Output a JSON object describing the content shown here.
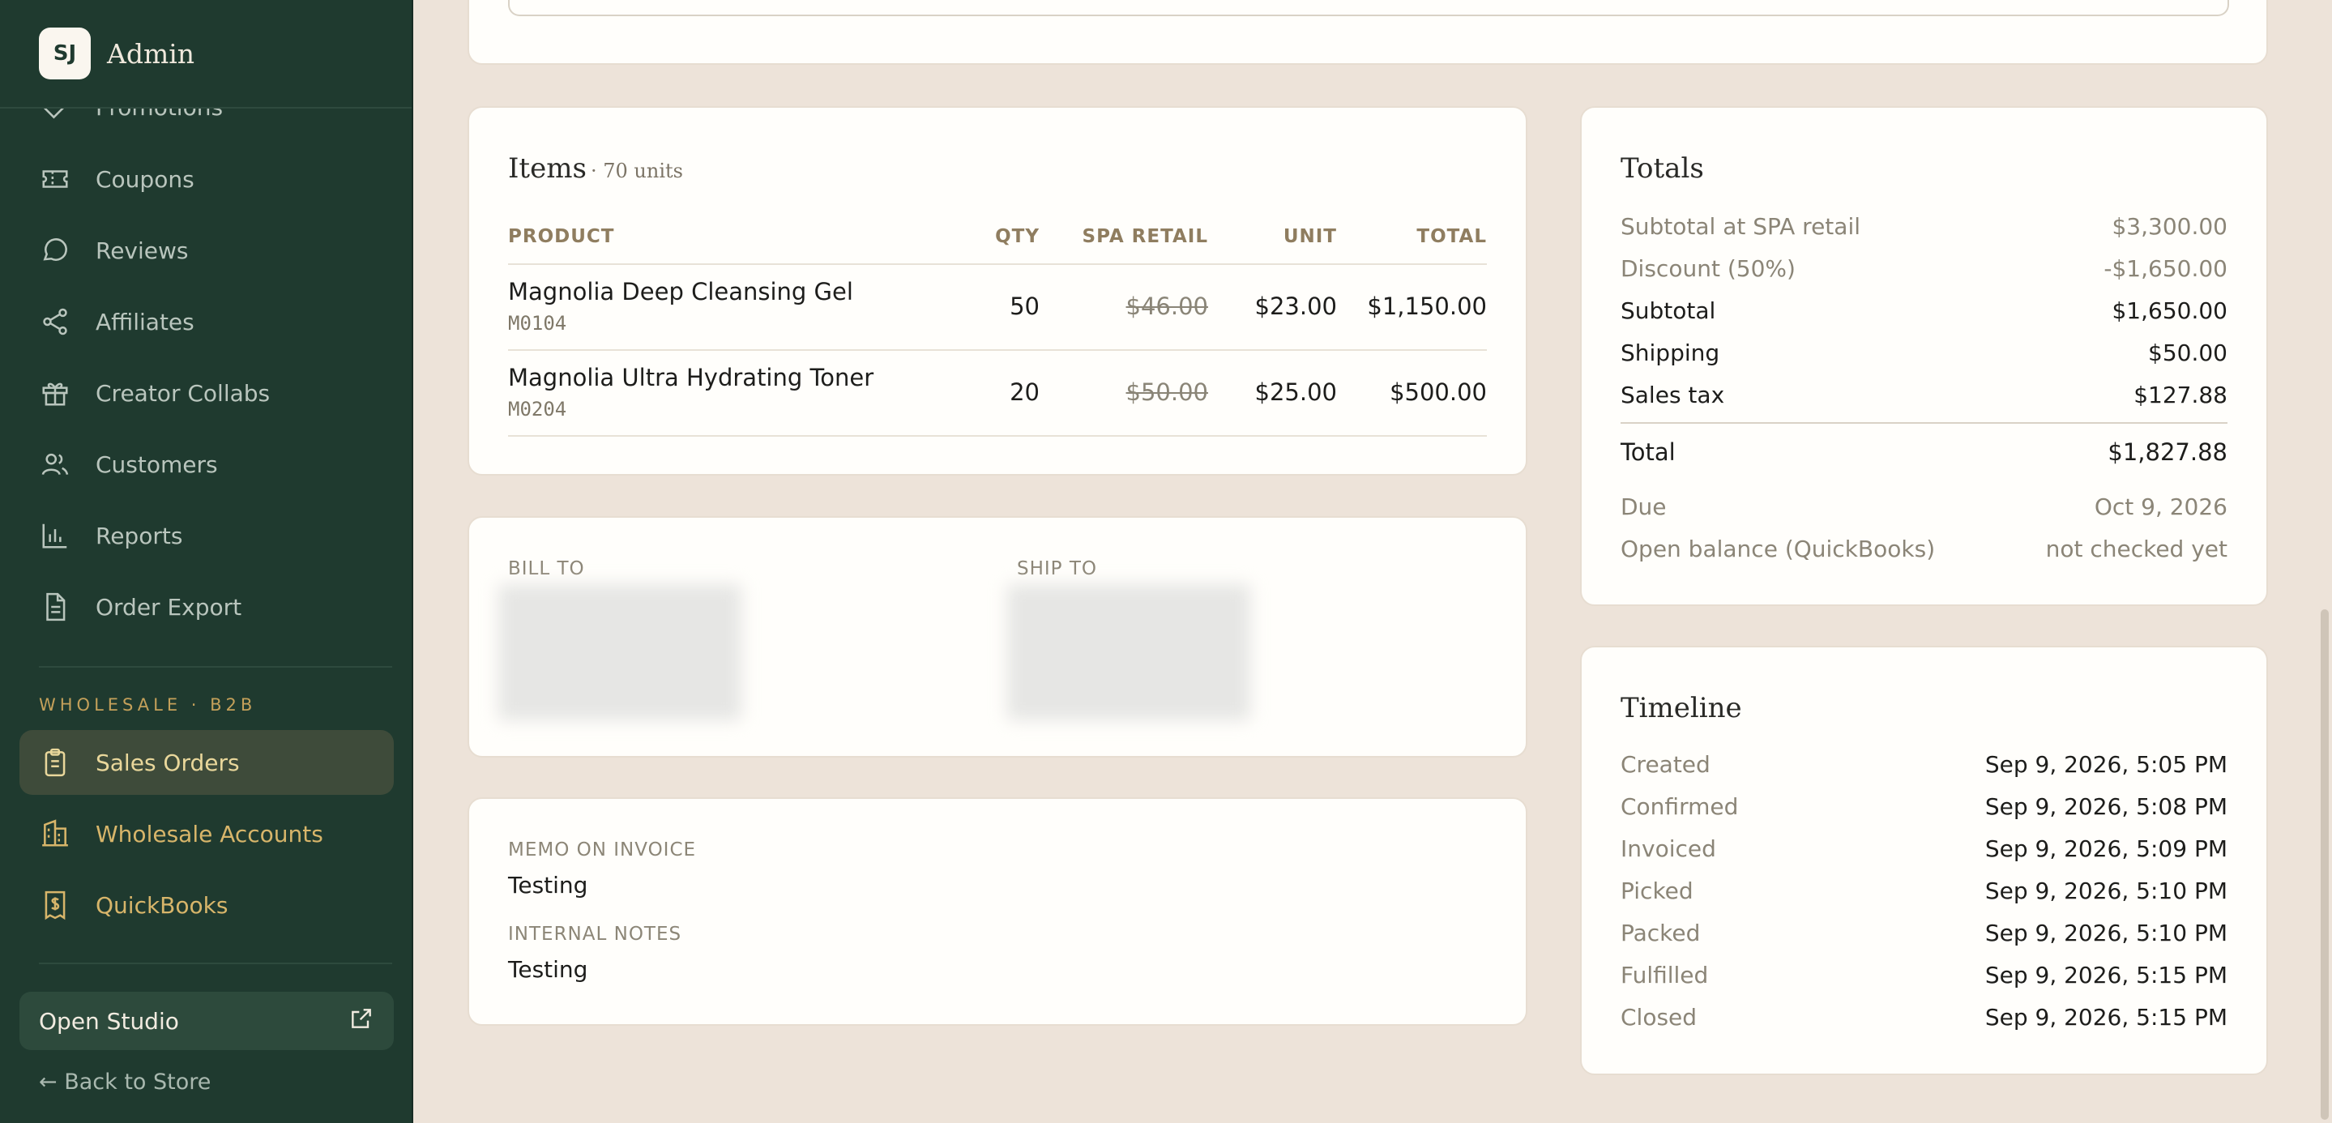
{
  "sidebar": {
    "avatar": "SJ",
    "title": "Admin",
    "nav_items": [
      "Promotions",
      "Coupons",
      "Reviews",
      "Affiliates",
      "Creator Collabs",
      "Customers",
      "Reports",
      "Order Export"
    ],
    "section_label": "WHOLESALE · B2B",
    "wholesale_items": [
      "Sales Orders",
      "Wholesale Accounts",
      "QuickBooks"
    ],
    "open_studio": "Open Studio",
    "back_to_store": "← Back to Store"
  },
  "items": {
    "title": "Items",
    "units": "· 70 units",
    "headers": {
      "product": "PRODUCT",
      "qty": "QTY",
      "spa_retail": "SPA RETAIL",
      "unit": "UNIT",
      "total": "TOTAL"
    },
    "rows": [
      {
        "name": "Magnolia Deep Cleansing Gel",
        "sku": "M0104",
        "qty": "50",
        "retail": "$46.00",
        "unit": "$23.00",
        "total": "$1,150.00"
      },
      {
        "name": "Magnolia Ultra Hydrating Toner",
        "sku": "M0204",
        "qty": "20",
        "retail": "$50.00",
        "unit": "$25.00",
        "total": "$500.00"
      }
    ]
  },
  "address": {
    "bill_to": "BILL TO",
    "ship_to": "SHIP TO"
  },
  "notes": {
    "memo_label": "MEMO ON INVOICE",
    "memo_value": "Testing",
    "internal_label": "INTERNAL NOTES",
    "internal_value": "Testing"
  },
  "totals": {
    "title": "Totals",
    "rows": [
      {
        "k": "Subtotal at SPA retail",
        "v": "$3,300.00"
      },
      {
        "k": "Discount (50%)",
        "v": "-$1,650.00"
      },
      {
        "k": "Subtotal",
        "v": "$1,650.00"
      },
      {
        "k": "Shipping",
        "v": "$50.00"
      },
      {
        "k": "Sales tax",
        "v": "$127.88"
      },
      {
        "k": "Total",
        "v": "$1,827.88"
      },
      {
        "k": "Due",
        "v": "Oct 9, 2026"
      },
      {
        "k": "Open balance (QuickBooks)",
        "v": "not checked yet"
      }
    ]
  },
  "timeline": {
    "title": "Timeline",
    "rows": [
      {
        "k": "Created",
        "v": "Sep 9, 2026, 5:05 PM"
      },
      {
        "k": "Confirmed",
        "v": "Sep 9, 2026, 5:08 PM"
      },
      {
        "k": "Invoiced",
        "v": "Sep 9, 2026, 5:09 PM"
      },
      {
        "k": "Picked",
        "v": "Sep 9, 2026, 5:10 PM"
      },
      {
        "k": "Packed",
        "v": "Sep 9, 2026, 5:10 PM"
      },
      {
        "k": "Fulfilled",
        "v": "Sep 9, 2026, 5:15 PM"
      },
      {
        "k": "Closed",
        "v": "Sep 9, 2026, 5:15 PM"
      }
    ]
  }
}
